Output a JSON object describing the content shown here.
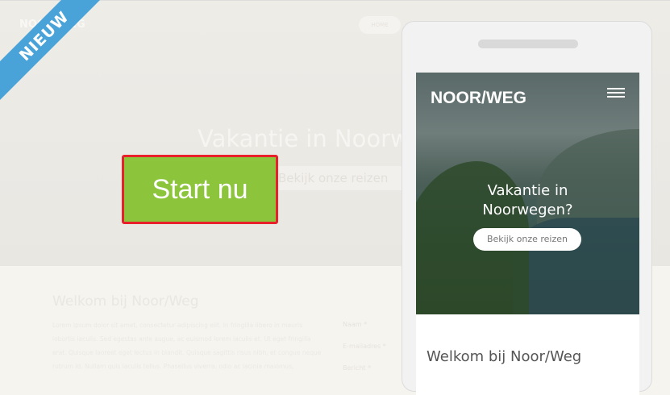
{
  "background": {
    "logo": "NOOR/WEG",
    "nav_button": "HOME",
    "hero_title": "Vakantie in Noorwegen?",
    "hero_button": "Bekijk onze reizen",
    "welcome_heading": "Welkom bij Noor/Weg",
    "welcome_text": "Lorem ipsum dolor sit amet, consectetur adipiscing elit. In fringilla libero in mauris lobortis iaculis. Sed egestas ante augue, ac euismod lorem iaculis et. Ut eget fringilla erat. Quisque laoreet eget lectus in blandit. Quisque sagittis risus nibh, et congue neque rutrum id. Nullam quis iaculis tellus. Phasellus viverra, odio ac lacinia maximus,",
    "form_labels": [
      "Naam *",
      "E-mailadres *",
      "Bericht *"
    ]
  },
  "ribbon": {
    "label": "NIEUW",
    "color": "#4aa3d8"
  },
  "cta": {
    "label": "Start nu",
    "color": "#8cc43c",
    "highlight_color": "#e8202a"
  },
  "phone": {
    "logo": "NOOR/WEG",
    "menu_icon": "hamburger-icon",
    "hero_title_line1": "Vakantie in",
    "hero_title_line2": "Noorwegen?",
    "hero_button": "Bekijk onze reizen",
    "welcome_heading": "Welkom bij Noor/Weg"
  }
}
